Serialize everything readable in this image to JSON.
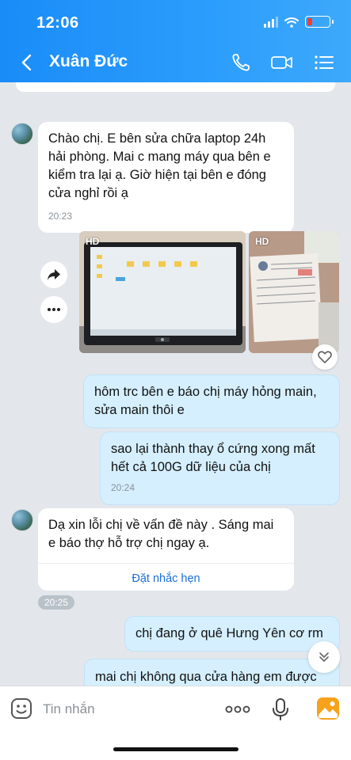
{
  "status_bar": {
    "time": "12:06"
  },
  "header": {
    "contact_name": "Xuân Đức"
  },
  "messages": {
    "m1": {
      "text": "Chào chị. E bên sửa chữa laptop 24h hải phòng. Mai c mang máy qua bên e kiểm tra lại ạ. Giờ hiện tại bên e đóng cửa nghỉ rồi ạ",
      "time": "20:23"
    },
    "photos": {
      "badge1": "HD",
      "badge2": "HD"
    },
    "m2": {
      "text": "hôm trc bên e báo chị máy hỏng main, sửa main thôi e"
    },
    "m3": {
      "text": "sao lại thành thay ổ cứng xong mất hết cả 100G dữ liệu của chị",
      "time": "20:24"
    },
    "m4": {
      "text": "Dạ xin lỗi chị về vấn đề này . Sáng mai e báo thợ hỗ trợ chị ngay ạ.",
      "reminder": "Đặt nhắc hẹn"
    },
    "pill_time": "20:25",
    "m5": {
      "text": "chị đang ở quê Hưng Yên cơ rm"
    },
    "m6": {
      "text": "mai chị không qua cửa hàng em được"
    }
  },
  "input": {
    "placeholder": "Tin nhắn"
  },
  "colors": {
    "header": "#1a8cf8",
    "outgoing_bubble": "#d5effe",
    "link": "#1a6fd6",
    "battery_low": "#ff3b30"
  }
}
